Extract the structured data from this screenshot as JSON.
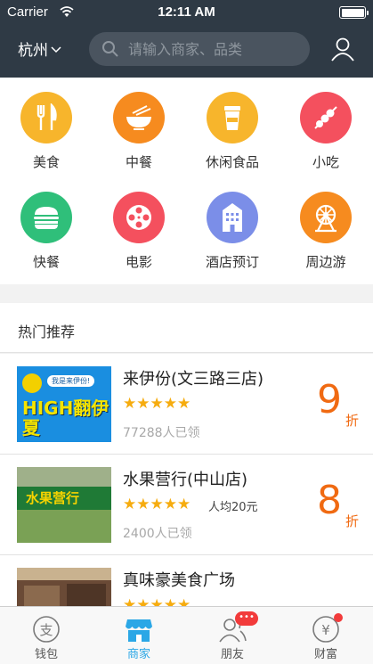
{
  "status_bar": {
    "carrier": "Carrier",
    "time": "12:11 AM"
  },
  "header": {
    "city": "杭州",
    "search_placeholder": "请输入商家、品类"
  },
  "categories": [
    {
      "label": "美食",
      "icon": "fork-knife-icon",
      "color": "#f7b52c"
    },
    {
      "label": "中餐",
      "icon": "rice-bowl-icon",
      "color": "#f68b1f"
    },
    {
      "label": "休闲食品",
      "icon": "drink-cup-icon",
      "color": "#f7b52c"
    },
    {
      "label": "小吃",
      "icon": "skewer-icon",
      "color": "#f4505e"
    },
    {
      "label": "快餐",
      "icon": "burger-icon",
      "color": "#2fbf7a"
    },
    {
      "label": "电影",
      "icon": "film-reel-icon",
      "color": "#f4505e"
    },
    {
      "label": "酒店预订",
      "icon": "hotel-building-icon",
      "color": "#7b8ee8"
    },
    {
      "label": "周边游",
      "icon": "ferris-wheel-icon",
      "color": "#f68b1f"
    }
  ],
  "recommend": {
    "title": "热门推荐",
    "items": [
      {
        "name": "来伊份(文三路三店)",
        "stars": "★★★★★",
        "avg_price": "",
        "sold": "77288人已领",
        "discount": "9",
        "unit": "折",
        "thumb_text": "HIGH翻伊夏",
        "thumb_bubble": "我是来伊份!"
      },
      {
        "name": "水果营行(中山店)",
        "stars": "★★★★★",
        "avg_price": "人均20元",
        "sold": "2400人已领",
        "discount": "8",
        "unit": "折",
        "thumb_text": "水果营行"
      },
      {
        "name": "真味豪美食广场",
        "stars": "★★★★★",
        "avg_price": "",
        "sold": "",
        "discount": "",
        "unit": ""
      }
    ]
  },
  "tabs": [
    {
      "label": "钱包",
      "icon": "wallet-icon",
      "active": false
    },
    {
      "label": "商家",
      "icon": "store-icon",
      "active": true
    },
    {
      "label": "朋友",
      "icon": "friends-icon",
      "active": false,
      "badge": "•••"
    },
    {
      "label": "财富",
      "icon": "wealth-icon",
      "active": false
    }
  ],
  "colors": {
    "header_bg": "#2f3a45",
    "accent_blue": "#2ba7e6",
    "discount_orange": "#f06a12",
    "star_yellow": "#f6ac0f"
  }
}
